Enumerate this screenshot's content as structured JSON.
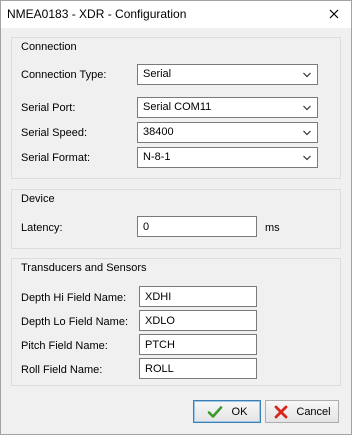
{
  "window": {
    "title": "NMEA0183 - XDR - Configuration",
    "close_icon": "close-icon"
  },
  "connection": {
    "group_title": "Connection",
    "type_label": "Connection Type:",
    "type_value": "Serial",
    "port_label": "Serial Port:",
    "port_value": "Serial COM11",
    "speed_label": "Serial Speed:",
    "speed_value": "38400",
    "format_label": "Serial Format:",
    "format_value": "N-8-1"
  },
  "device": {
    "group_title": "Device",
    "latency_label": "Latency:",
    "latency_value": "0",
    "latency_unit": "ms"
  },
  "transducers": {
    "group_title": "Transducers and Sensors",
    "depth_hi_label": "Depth Hi Field Name:",
    "depth_hi_value": "XDHI",
    "depth_lo_label": "Depth Lo Field Name:",
    "depth_lo_value": "XDLO",
    "pitch_label": "Pitch Field Name:",
    "pitch_value": "PTCH",
    "roll_label": "Roll Field Name:",
    "roll_value": "ROLL"
  },
  "buttons": {
    "ok_label": "OK",
    "ok_icon": "check-icon",
    "cancel_label": "Cancel",
    "cancel_icon": "x-icon"
  },
  "colors": {
    "ok_icon": "#3c9a2a",
    "cancel_icon": "#d9261c"
  }
}
